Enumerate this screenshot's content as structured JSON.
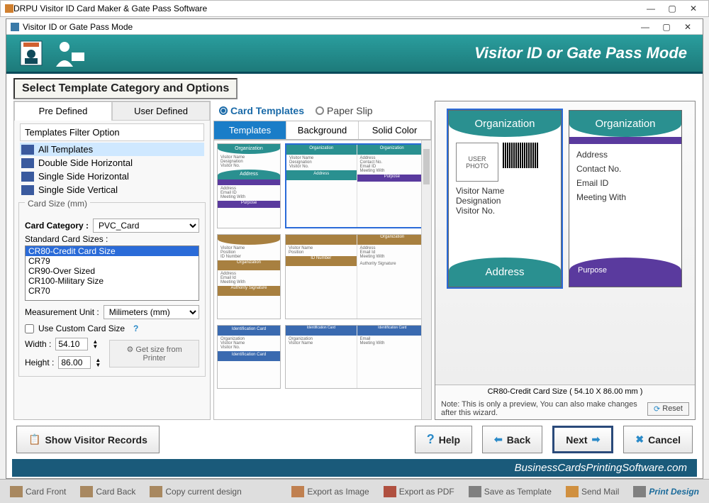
{
  "window": {
    "title": "DRPU Visitor ID Card Maker & Gate Pass Software"
  },
  "subwindow": {
    "title": "Visitor ID or Gate Pass Mode"
  },
  "banner": {
    "title": "Visitor ID or Gate Pass Mode"
  },
  "section": {
    "title": "Select Template Category and Options"
  },
  "leftTabs": {
    "predefined": "Pre Defined",
    "userdefined": "User Defined"
  },
  "filter": {
    "heading": "Templates Filter Option",
    "items": [
      "All Templates",
      "Double Side Horizontal",
      "Single Side Horizontal",
      "Single Side Vertical"
    ]
  },
  "cardsize": {
    "legend": "Card Size (mm)",
    "categoryLabel": "Card Category :",
    "category": "PVC_Card",
    "sizesLabel": "Standard Card Sizes :",
    "sizes": [
      "CR80-Credit Card Size",
      "CR79",
      "CR90-Over Sized",
      "CR100-Military Size",
      "CR70"
    ],
    "unitLabel": "Measurement Unit :",
    "unit": "Milimeters (mm)",
    "customLabel": "Use Custom Card Size",
    "widthLabel": "Width :",
    "width": "54.10",
    "heightLabel": "Height :",
    "height": "86.00",
    "getSize": "Get size from Printer"
  },
  "mid": {
    "radios": {
      "templates": "Card Templates",
      "paper": "Paper Slip"
    },
    "tabs": {
      "templates": "Templates",
      "background": "Background",
      "solid": "Solid Color"
    }
  },
  "preview": {
    "org": "Organization",
    "userPhoto": "USER PHOTO",
    "visitorName": "Visitor Name",
    "designation": "Designation",
    "visitorNo": "Visitor No.",
    "address": "Address",
    "contact": "Contact No.",
    "email": "Email ID",
    "meeting": "Meeting With",
    "purpose": "Purpose",
    "footer": "CR80-Credit Card Size ( 54.10 X 86.00 mm )",
    "note": "Note: This is only a preview, You can also make changes after this wizard.",
    "reset": "Reset"
  },
  "buttons": {
    "records": "Show Visitor Records",
    "help": "Help",
    "back": "Back",
    "next": "Next",
    "cancel": "Cancel"
  },
  "url": "BusinessCardsPrintingSoftware.com",
  "bottom": {
    "front": "Card Front",
    "back": "Card Back",
    "copy": "Copy current design",
    "img": "Export as Image",
    "pdf": "Export as PDF",
    "tpl": "Save as Template",
    "mail": "Send Mail",
    "print": "Print Design"
  }
}
